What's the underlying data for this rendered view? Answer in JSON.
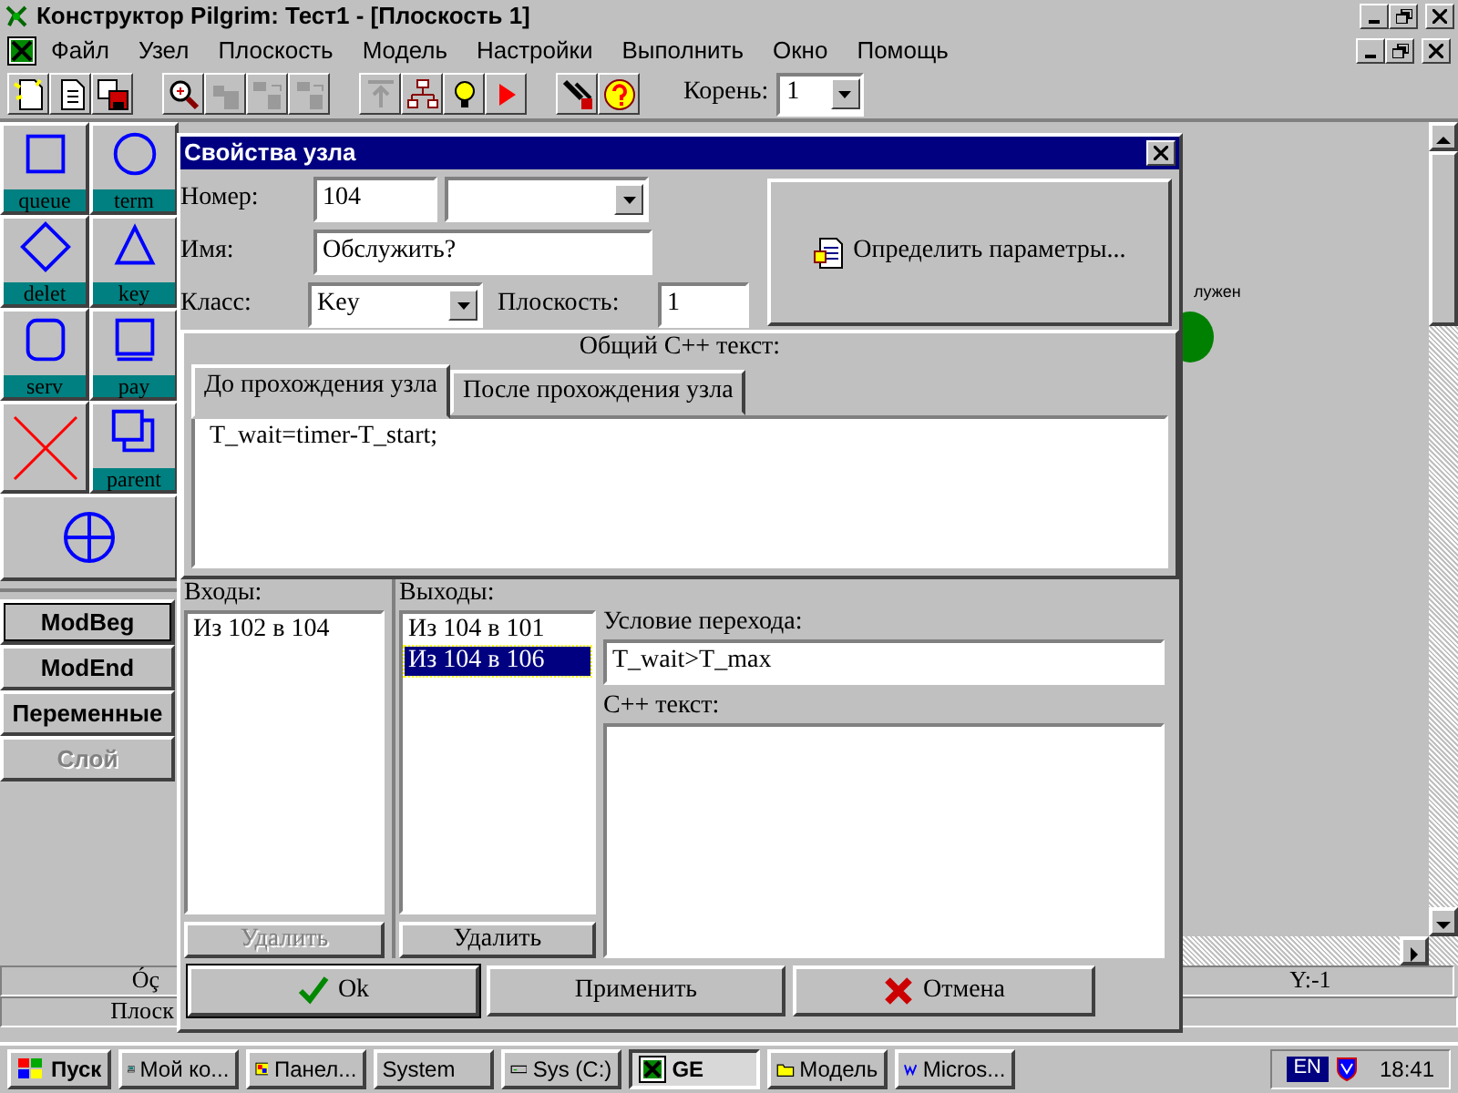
{
  "window": {
    "title": "Конструктор Pilgrim: Тест1 - [Плоскость 1]"
  },
  "menu": [
    "Файл",
    "Узел",
    "Плоскость",
    "Модель",
    "Настройки",
    "Выполнить",
    "Окно",
    "Помощь"
  ],
  "toolbar": {
    "groups": [
      [
        {
          "kind": "new",
          "disabled": false
        },
        {
          "kind": "open",
          "disabled": false
        },
        {
          "kind": "save",
          "disabled": false
        }
      ],
      [
        {
          "kind": "zoom",
          "disabled": false
        },
        {
          "kind": "copy",
          "disabled": true
        },
        {
          "kind": "left",
          "disabled": true
        },
        {
          "kind": "right",
          "disabled": true
        }
      ],
      [
        {
          "kind": "up",
          "disabled": true
        },
        {
          "kind": "tree",
          "disabled": false
        },
        {
          "kind": "bulb",
          "disabled": false
        },
        {
          "kind": "run",
          "disabled": false
        }
      ],
      [
        {
          "kind": "tools",
          "disabled": false
        },
        {
          "kind": "help",
          "disabled": false
        }
      ]
    ],
    "root_label": "Корень:",
    "root_value": "1"
  },
  "palette": [
    {
      "kind": "square",
      "label": "queue"
    },
    {
      "kind": "circle",
      "label": "term"
    },
    {
      "kind": "diamond",
      "label": "delet"
    },
    {
      "kind": "triangle",
      "label": "key"
    },
    {
      "kind": "rounded",
      "label": "serv"
    },
    {
      "kind": "book",
      "label": "pay"
    },
    {
      "kind": "cross"
    },
    {
      "kind": "stack",
      "label": "parent"
    },
    {
      "kind": "crosshair"
    }
  ],
  "mode_buttons": [
    {
      "label": "ModBeg",
      "selected": true,
      "disabled": false
    },
    {
      "label": "ModEnd",
      "selected": false,
      "disabled": false
    },
    {
      "label": "Переменные",
      "selected": false,
      "disabled": false
    },
    {
      "label": "Слой",
      "selected": false,
      "disabled": true
    }
  ],
  "canvas": {
    "node_label": "лужен"
  },
  "status_bar": {
    "row_1": [
      "Óç",
      "Y:-1"
    ],
    "row_2": [
      "Плоск"
    ]
  },
  "dialog": {
    "title": "Свойства узла",
    "number_label": "Номер:",
    "number": "104",
    "name_label": "Имя:",
    "name": "Обслужить?",
    "class_label": "Класс:",
    "class": "Key",
    "plane_label": "Плоскость:",
    "plane": "1",
    "params_button": "Определить параметры...",
    "shared_label": "Общий C++ текст:",
    "tabs": [
      {
        "label": "До прохождения узла",
        "selected": true
      },
      {
        "label": "После прохождения узла",
        "selected": false
      }
    ],
    "code": "T_wait=timer-T_start;",
    "inputs": {
      "label": "Входы:",
      "items": [
        {
          "text": "Из 102 в 104",
          "selected": false
        }
      ],
      "delete_button": {
        "label": "Удалить",
        "disabled": true
      }
    },
    "outputs": {
      "label": "Выходы:",
      "items": [
        {
          "text": "Из 104 в 101",
          "selected": false
        },
        {
          "text": "Из 104 в 106",
          "selected": true
        }
      ],
      "delete_button": {
        "label": "Удалить",
        "disabled": false
      }
    },
    "condition_label": "Условие перехода:",
    "condition": "T_wait>T_max",
    "cpp_label": "C++ текст:",
    "buttons": [
      {
        "kind": "ok",
        "label": "Ok",
        "default": true
      },
      {
        "kind": "apply",
        "label": "Применить",
        "default": false
      },
      {
        "kind": "cancel",
        "label": "Отмена",
        "default": false
      }
    ]
  },
  "taskbar": {
    "start": "Пуск",
    "tasks": [
      {
        "kind": "computer",
        "label": "Мой ко...",
        "selected": false
      },
      {
        "kind": "panel",
        "label": "Панел...",
        "selected": false
      },
      {
        "kind": "none",
        "label": "System",
        "selected": false
      },
      {
        "kind": "drive",
        "label": "Sys (C:)",
        "selected": false
      },
      {
        "kind": "app",
        "label": "GE",
        "selected": true
      },
      {
        "kind": "folder",
        "label": "Модель",
        "selected": false
      },
      {
        "kind": "word",
        "label": "Micros...",
        "selected": false
      }
    ],
    "lang": "EN",
    "clock": "18:41"
  }
}
